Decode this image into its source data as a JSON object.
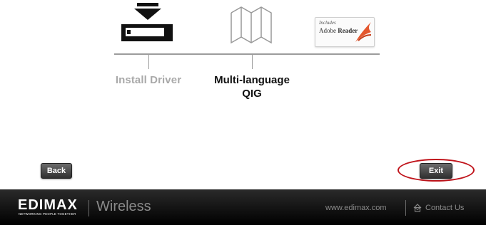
{
  "steps": {
    "install_driver": "Install Driver",
    "qig_line1": "Multi-language",
    "qig_line2": "QIG"
  },
  "adobe": {
    "includes": "Includes",
    "brand": "Adobe",
    "product": "Reader"
  },
  "buttons": {
    "back": "Back",
    "exit": "Exit"
  },
  "footer": {
    "logo_word": "EDIMAX",
    "logo_tagline": "NETWORKING PEOPLE TOGETHER",
    "section": "Wireless",
    "website": "www.edimax.com",
    "contact": "Contact Us"
  },
  "colors": {
    "highlight": "#c0141b",
    "inactive_label": "#a9a9a9",
    "footer_bg": "#000000"
  },
  "icons": {
    "driver": "download-drive-icon",
    "qig": "folded-map-icon",
    "adobe": "adobe-reader-badge",
    "contact": "house-mail-icon"
  }
}
